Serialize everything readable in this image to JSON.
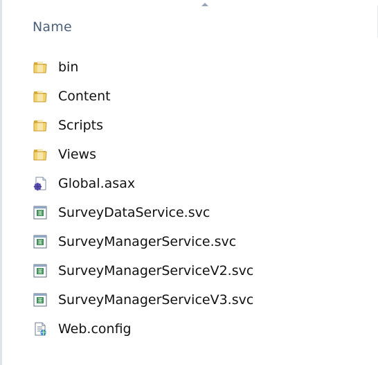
{
  "header": {
    "name_label": "Name"
  },
  "files": [
    {
      "label": "bin",
      "icon": "folder-icon"
    },
    {
      "label": "Content",
      "icon": "folder-icon"
    },
    {
      "label": "Scripts",
      "icon": "folder-icon"
    },
    {
      "label": "Views",
      "icon": "folder-icon"
    },
    {
      "label": "Global.asax",
      "icon": "asax-file-icon"
    },
    {
      "label": "SurveyDataService.svc",
      "icon": "svc-file-icon"
    },
    {
      "label": "SurveyManagerService.svc",
      "icon": "svc-file-icon"
    },
    {
      "label": "SurveyManagerServiceV2.svc",
      "icon": "svc-file-icon"
    },
    {
      "label": "SurveyManagerServiceV3.svc",
      "icon": "svc-file-icon"
    },
    {
      "label": "Web.config",
      "icon": "config-file-icon"
    }
  ],
  "colors": {
    "header_text": "#4c607a",
    "folder": "#e8c35a",
    "text": "#111111"
  }
}
